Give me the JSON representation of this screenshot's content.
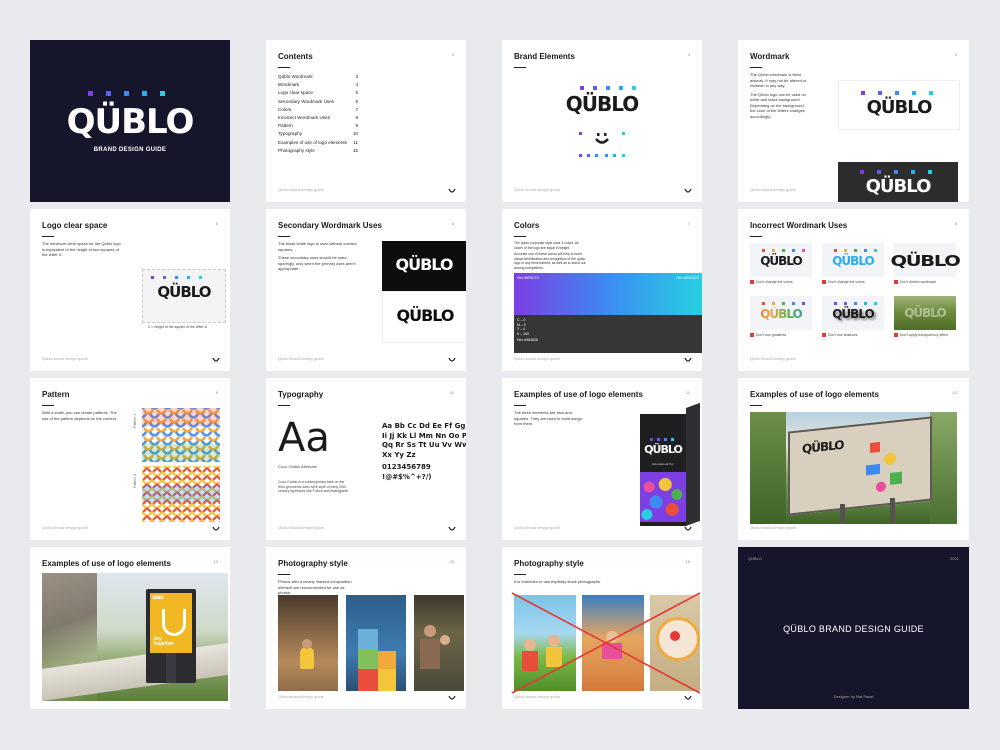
{
  "brand": {
    "logo": "QÜBLO",
    "colors": {
      "navy": "#15162b",
      "blue": "#3d6ff2",
      "purple": "#7b3fe4",
      "cyan": "#25d0e0"
    }
  },
  "footer": "Qüblo brand design guide",
  "slides": {
    "cover": {
      "subtitle": "BRAND DESIGN GUIDE"
    },
    "contents": {
      "title": "Contents",
      "num": "2",
      "items": [
        {
          "label": "Qüblo Wordmark",
          "page": "3"
        },
        {
          "label": "Wordmark",
          "page": "4"
        },
        {
          "label": "Logo clear space",
          "page": "5"
        },
        {
          "label": "Secondary Wordmark Uses",
          "page": "6"
        },
        {
          "label": "Colors",
          "page": "7"
        },
        {
          "label": "Incorrect Wordmark Uses",
          "page": "8"
        },
        {
          "label": "Pattern",
          "page": "9"
        },
        {
          "label": "Typography",
          "page": "10"
        },
        {
          "label": "Examples of use of logo elements",
          "page": "11"
        },
        {
          "label": "Photography style",
          "page": "15"
        }
      ]
    },
    "brand_elements": {
      "title": "Brand Elements",
      "num": "3"
    },
    "wordmark": {
      "title": "Wordmark",
      "num": "4",
      "body1": "The Qüblo wordmark is fixed artwork. It may not be altered or redrawn in any way.",
      "body2": "The Qüblo logo can be used on white and black background. Depending on the background, the color of the letters changes accordingly."
    },
    "clear_space": {
      "title": "Logo clear space",
      "num": "5",
      "body": "The minimum clear space for the Qüblo logo is equivalent of the height of two squares of the letter Ü.",
      "caption": "X = height of the square of the letter Ü"
    },
    "secondary": {
      "title": "Secondary Wordmark Uses",
      "num": "6",
      "body1": "The black-white logo is used without colored squares.",
      "body2": "These secondary uses should be used sparingly, only when the primary uses aren't appropriate."
    },
    "colors": {
      "title": "Colors",
      "num": "7",
      "body1": "The qublo corporate style uses 3 colors. All colors of the logo are equal in weight.",
      "body2": "Accurate use of these colors will help to build visual identification and recognition of the qublo logo in any environment, as well as to stand out among competitors.",
      "swatch_left": "Hex #6F6CF2",
      "swatch_right": "Hex #00D4CD",
      "dark_lines": [
        "C – 0",
        "M – 0",
        "Y – 0",
        "K – 100"
      ],
      "dark_hex": "Hex #363636"
    },
    "incorrect": {
      "title": "Incorrect Wordmark Uses",
      "num": "8",
      "captions": [
        "Don't change the colors",
        "Don't change the colors",
        "Don't stretch wordmark",
        "Don't use gradients",
        "Don't use shadows",
        "Don't apply transparency effect"
      ]
    },
    "pattern": {
      "title": "Pattern",
      "num": "9",
      "body": "With a smile, you can create patterns. The use of the pattern depends on the context.",
      "label1": "Pattern 1",
      "label2": "Pattern 2"
    },
    "typography": {
      "title": "Typography",
      "num": "10",
      "sample": "Aa",
      "font_name": "Coco Gothic Alternate",
      "alphabet": [
        "Aa Bb Cc Dd Ee Ff Gg Hh",
        "Ii Jj Kk Ll Mm Nn Oo Pp",
        "Qq Rr Ss Tt Uu Vv Ww",
        "Xx Yy Zz"
      ],
      "digits": "0123456789",
      "symbols": "!@#$%^+?/)",
      "body": "Coco Gothic is a contemporary take on the retro geometric sans serif style of early 20th century typefaces like Futura and Avantgarde."
    },
    "examples1": {
      "title": "Examples of use of logo elements",
      "num": "11",
      "body": "The three elements are arcs and squares. They are used to build songs from them.",
      "box_label": "Educational Toy"
    },
    "examples2": {
      "title": "Examples of use of logo elements",
      "num": "12"
    },
    "examples3": {
      "title": "Examples of use of logo elements",
      "num": "13",
      "poster_text": "Joy Together"
    },
    "photo1": {
      "title": "Photography style",
      "num": "15",
      "body": "Photos with a clearly marked composition element are recommended for use as photos."
    },
    "photo2": {
      "title": "Photography style",
      "num": "16",
      "body": "It is forbidden to use explicitly stock photographs."
    },
    "back": {
      "top_left": "QÜBLO",
      "top_right": "2021",
      "title": "QÜBLO BRAND DESIGN GUIDE",
      "credit": "Designer by Nat Pavel"
    }
  }
}
